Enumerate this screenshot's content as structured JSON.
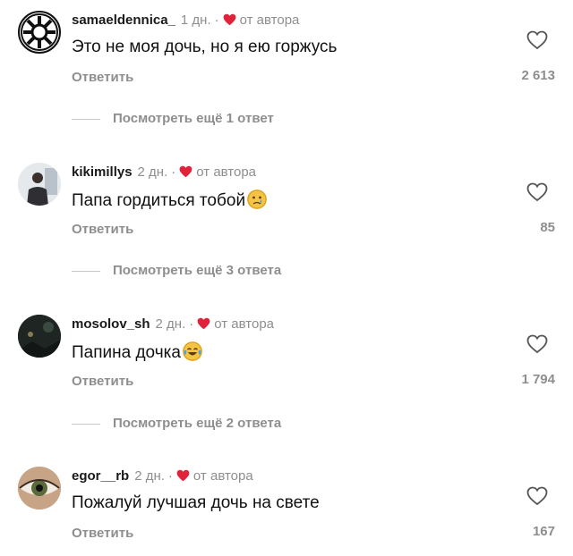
{
  "comments": [
    {
      "username": "samaeldennica_",
      "time": "1 дн.",
      "dot": "·",
      "author_label": "от автора",
      "text": "Это не моя дочь, но я ею горжусь",
      "emoji": "",
      "reply_label": "Ответить",
      "likes": "2 613",
      "view_more": "Посмотреть ещё 1 ответ",
      "avatar": "empire-emblem"
    },
    {
      "username": "kikimillys",
      "time": "2 дн.",
      "dot": "·",
      "author_label": "от автора",
      "text": "Папа гордиться тобой",
      "emoji": "crying-face",
      "reply_label": "Ответить",
      "likes": "85",
      "view_more": "Посмотреть ещё 3 ответа",
      "avatar": "person-photo"
    },
    {
      "username": "mosolov_sh",
      "time": "2 дн.",
      "dot": "·",
      "author_label": "от автора",
      "text": "Папина дочка",
      "emoji": "tears-of-joy",
      "reply_label": "Ответить",
      "likes": "1 794",
      "view_more": "Посмотреть ещё 2 ответа",
      "avatar": "dark-photo"
    },
    {
      "username": "egor__rb",
      "time": "2 дн.",
      "dot": "·",
      "author_label": "от автора",
      "text": "Пожалуй лучшая дочь на свете",
      "emoji": "",
      "reply_label": "Ответить",
      "likes": "167",
      "view_more": "",
      "avatar": "eye-photo"
    }
  ],
  "colors": {
    "heart": "#e0233a",
    "muted": "#8e8e8e",
    "text": "#111111"
  }
}
